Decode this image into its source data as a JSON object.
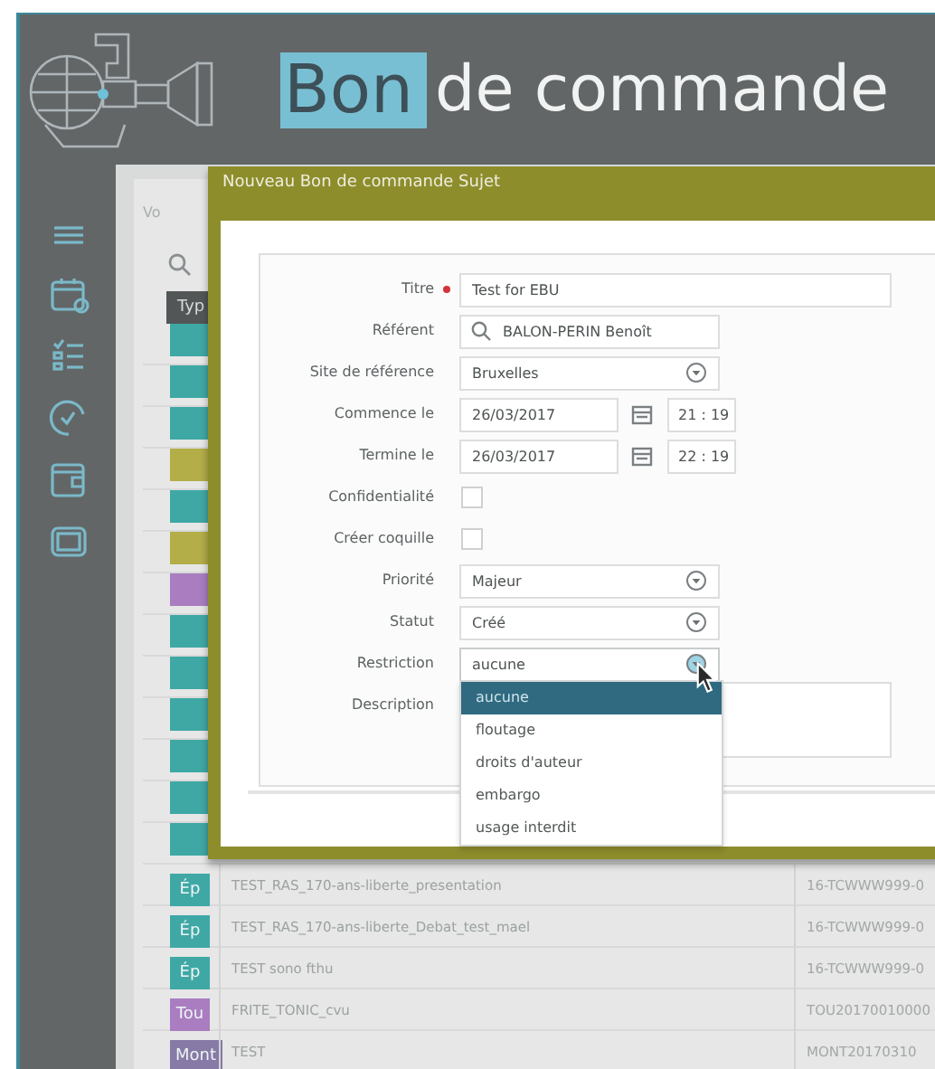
{
  "header": {
    "logo_highlight": "Bon",
    "logo_text": "de commande"
  },
  "list": {
    "heading": "Vo",
    "column_header": "Typ",
    "rows": [
      {
        "color": "#3fa8a5"
      },
      {
        "color": "#3fa8a5"
      },
      {
        "color": "#3fa8a5"
      },
      {
        "color": "#b3ae48"
      },
      {
        "color": "#3fa8a5"
      },
      {
        "color": "#b3ae48"
      },
      {
        "color": "#a97dc0"
      },
      {
        "color": "#3fa8a5"
      },
      {
        "color": "#3fa8a5"
      },
      {
        "color": "#3fa8a5"
      },
      {
        "color": "#3fa8a5"
      },
      {
        "color": "#3fa8a5"
      },
      {
        "color": "#3fa8a5"
      },
      {
        "tag": "Ép",
        "color": "#3fa8a5",
        "title": "TEST_RAS_170-ans-liberte_presentation",
        "code": "16-TCWWW999-0"
      },
      {
        "tag": "Ép",
        "color": "#3fa8a5",
        "title": "TEST_RAS_170-ans-liberte_Debat_test_mael",
        "code": "16-TCWWW999-0"
      },
      {
        "tag": "Ép",
        "color": "#3fa8a5",
        "title": "TEST sono fthu",
        "code": "16-TCWWW999-0"
      },
      {
        "tag": "Tou",
        "color": "#a97dc0",
        "title": "FRITE_TONIC_cvu",
        "code": "TOU20170010000"
      },
      {
        "tag": "Mont",
        "color": "#877aa6",
        "title": "TEST",
        "code": "MONT20170310"
      }
    ]
  },
  "dialog": {
    "title": "Nouveau Bon de commande Sujet",
    "fields": [
      {
        "kind": "text",
        "label": "Titre",
        "required": true,
        "value": "Test for EBU"
      },
      {
        "kind": "lookup",
        "label": "Référent",
        "required": false,
        "value": "BALON-PERIN Benoît"
      },
      {
        "kind": "select",
        "label": "Site de référence",
        "required": false,
        "value": "Bruxelles",
        "expanded": false
      },
      {
        "kind": "datetime",
        "label": "Commence le",
        "required": false,
        "date": "26/03/2017",
        "time": "21 : 19"
      },
      {
        "kind": "datetime",
        "label": "Termine le",
        "required": false,
        "date": "26/03/2017",
        "time": "22 : 19"
      },
      {
        "kind": "checkbox",
        "label": "Confidentialité",
        "required": false,
        "checked": false
      },
      {
        "kind": "checkbox",
        "label": "Créer coquille",
        "required": false,
        "checked": false
      },
      {
        "kind": "select",
        "label": "Priorité",
        "required": false,
        "value": "Majeur",
        "expanded": false
      },
      {
        "kind": "select",
        "label": "Statut",
        "required": false,
        "value": "Créé",
        "expanded": false
      },
      {
        "kind": "select",
        "label": "Restriction",
        "required": false,
        "value": "aucune",
        "expanded": true,
        "options": [
          {
            "label": "aucune",
            "selected": true
          },
          {
            "label": "floutage",
            "selected": false
          },
          {
            "label": "droits d'auteur",
            "selected": false
          },
          {
            "label": "embargo",
            "selected": false
          },
          {
            "label": "usage interdit",
            "selected": false
          }
        ]
      },
      {
        "kind": "textarea",
        "label": "Description",
        "required": false
      }
    ]
  }
}
